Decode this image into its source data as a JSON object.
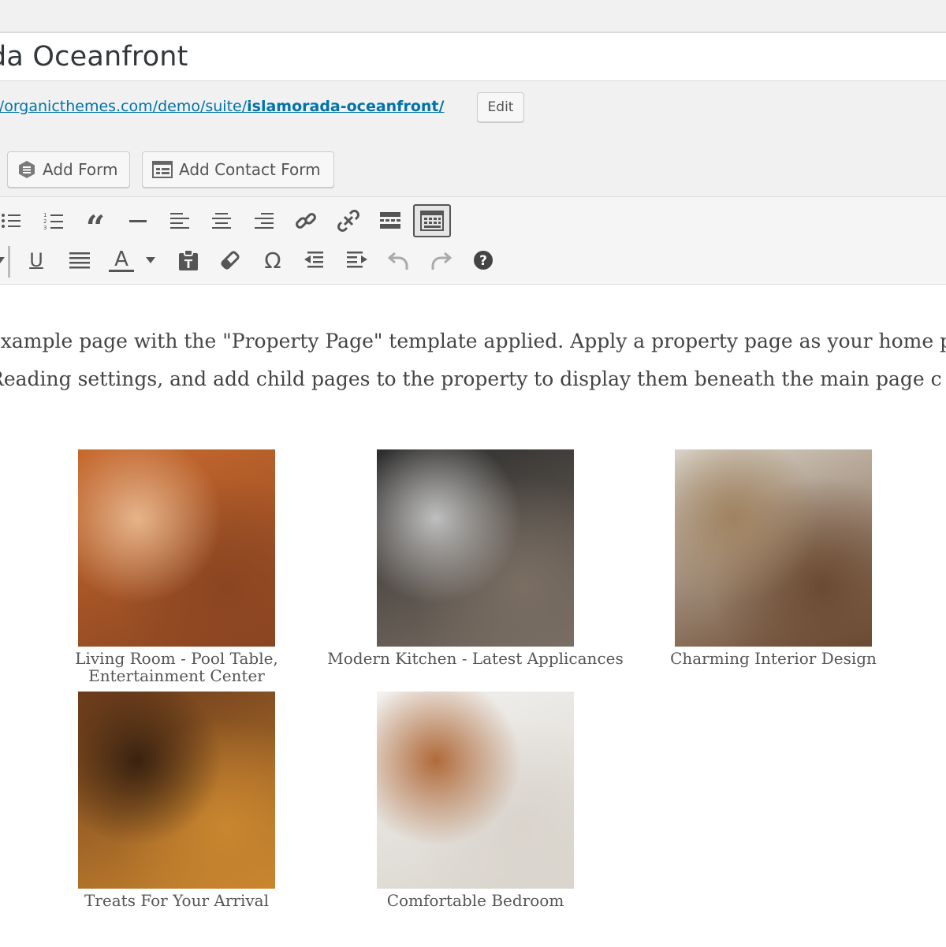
{
  "title": "da Oceanfront",
  "permalink": {
    "url_prefix": "://organicthemes.com/demo/suite/",
    "url_slug": "islamorada-oceanfront/",
    "edit_label": "Edit"
  },
  "media_buttons": {
    "add_form": "Add Form",
    "add_contact_form": "Add Contact Form"
  },
  "toolbar": {
    "row1": [
      "bullet-list-icon",
      "numbered-list-icon",
      "blockquote-icon",
      "horizontal-line-icon",
      "align-left-icon",
      "align-center-icon",
      "align-right-icon",
      "insert-link-icon",
      "remove-link-icon",
      "read-more-icon",
      "toolbar-toggle-icon"
    ],
    "row2": [
      "format-dropdown-icon",
      "underline-icon",
      "justify-icon",
      "text-color-icon",
      "text-color-dropdown-icon",
      "paste-text-icon",
      "clear-formatting-icon",
      "special-character-icon",
      "outdent-icon",
      "indent-icon",
      "undo-icon",
      "redo-icon",
      "help-icon"
    ],
    "underline_glyph": "U",
    "text_color_glyph": "A",
    "omega_glyph": "Ω",
    "help_glyph": "?",
    "quote_glyph": "“"
  },
  "content": {
    "line1": "example page with the \"Property Page\" template applied. Apply a property page as your home p",
    "line2": " Reading settings, and add child pages to the property to display them beneath the main page c"
  },
  "gallery": [
    {
      "caption": "Living Room - Pool Table, Entertainment Center",
      "colors": [
        "#c8692e",
        "#8a4521",
        "#e6b48a"
      ]
    },
    {
      "caption": "Modern Kitchen - Latest Applicances",
      "colors": [
        "#2d2d2d",
        "#7a6e63",
        "#bfbfbf"
      ]
    },
    {
      "caption": "Charming Interior Design",
      "colors": [
        "#d8d2c6",
        "#6b4a32",
        "#a0825f"
      ]
    },
    {
      "caption": "Treats For Your Arrival",
      "colors": [
        "#6b3b1c",
        "#c9862f",
        "#3a2210"
      ]
    },
    {
      "caption": "Comfortable Bedroom",
      "colors": [
        "#f2f1ef",
        "#d9d4cc",
        "#b06a3a"
      ]
    }
  ]
}
